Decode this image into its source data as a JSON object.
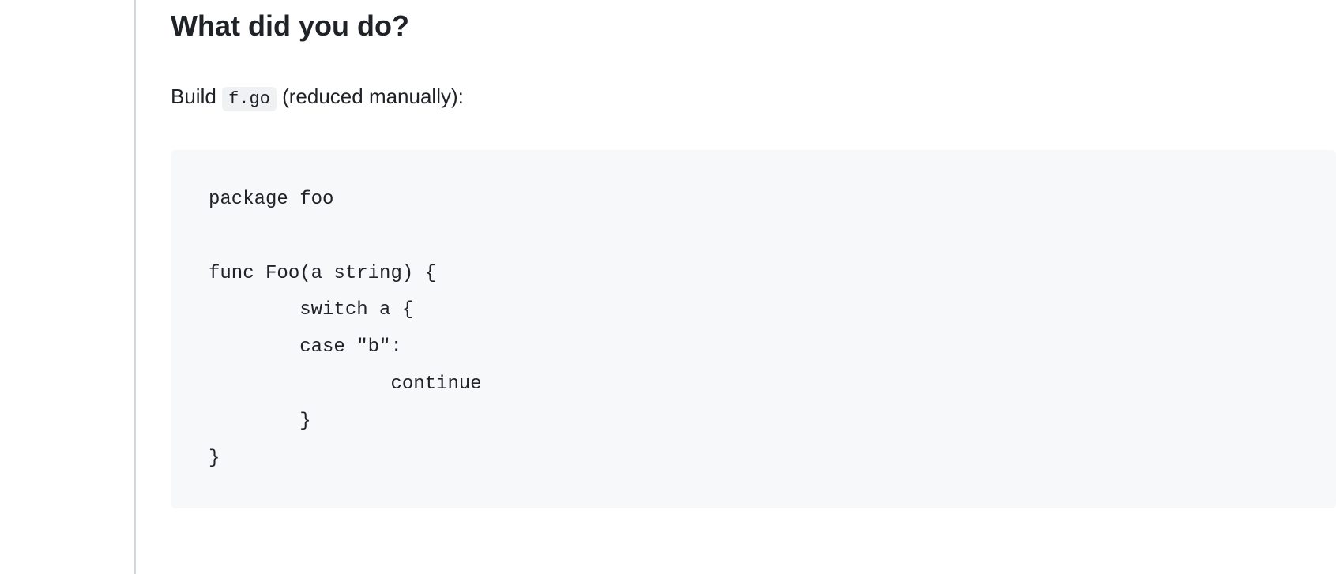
{
  "section": {
    "heading": "What did you do?",
    "description_before": "Build",
    "description_code": "f.go",
    "description_after": " (reduced manually):"
  },
  "code": {
    "content": "package foo\n\nfunc Foo(a string) {\n        switch a {\n        case \"b\":\n                continue\n        }\n}"
  }
}
